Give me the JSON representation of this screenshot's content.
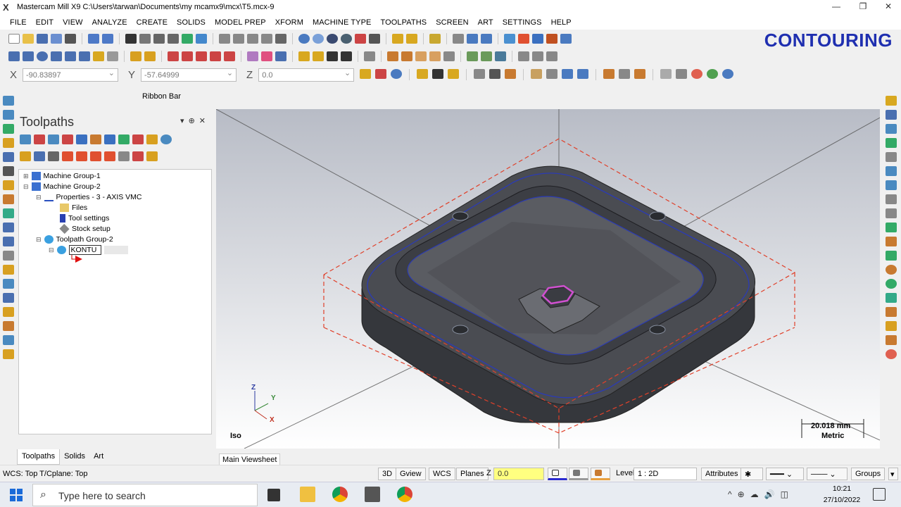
{
  "app": {
    "title": "Mastercam Mill X9  C:\\Users\\tarwan\\Documents\\my mcamx9\\mcx\\T5.mcx-9",
    "overlay_label": "CONTOURING"
  },
  "menu": [
    "FILE",
    "EDIT",
    "VIEW",
    "ANALYZE",
    "CREATE",
    "SOLIDS",
    "MODEL PREP",
    "XFORM",
    "MACHINE TYPE",
    "TOOLPATHS",
    "SCREEN",
    "ART",
    "SETTINGS",
    "HELP"
  ],
  "coords": {
    "x_label": "X",
    "x_value": "-90.83897",
    "y_label": "Y",
    "y_value": "-57.64999",
    "z_label": "Z",
    "z_value": "0.0"
  },
  "ribbon_bar_label": "Ribbon Bar",
  "toolpaths_panel": {
    "title": "Toolpaths",
    "tree": {
      "machine_group_1": "Machine Group-1",
      "machine_group_2": "Machine Group-2",
      "properties": "Properties - 3 - AXIS VMC",
      "files": "Files",
      "tool_settings": "Tool settings",
      "stock_setup": "Stock setup",
      "toolpath_group_2": "Toolpath Group-2",
      "edit_value": "KONTU"
    },
    "tabs": [
      "Toolpaths",
      "Solids",
      "Art"
    ]
  },
  "viewport": {
    "view_name": "Iso",
    "scale_value": "20.018 mm",
    "scale_unit": "Metric",
    "tab_label": "Main Viewsheet",
    "axes": {
      "z": "Z",
      "y": "Y",
      "x": "X"
    }
  },
  "status": {
    "wcs": "WCS: Top  T/Cplane: Top",
    "btn_3d": "3D",
    "gview": "Gview",
    "wcs_btn": "WCS",
    "planes": "Planes",
    "z_label": "Z",
    "z_value": "0.0",
    "level_label": "Level",
    "level_value": "1 : 2D",
    "attributes": "Attributes",
    "groups": "Groups"
  },
  "taskbar": {
    "search_placeholder": "Type here to search",
    "time": "10:21",
    "date": "27/10/2022"
  },
  "colors": {
    "accent": "#1f2fb0",
    "part": "#3f4147",
    "stock_outline": "#e0402a",
    "contour_path": "#2b3bb5",
    "hex_path": "#d050d0"
  }
}
